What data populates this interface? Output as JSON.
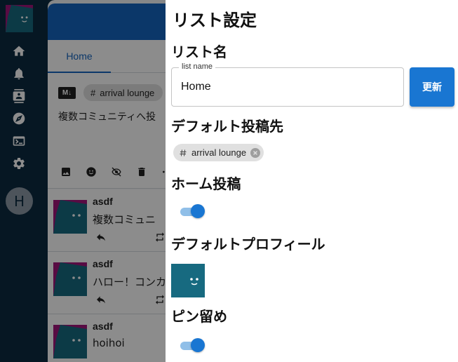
{
  "sidebar": {
    "avatar_label": "user avatar",
    "icons": [
      "home-icon",
      "bell-icon",
      "contacts-icon",
      "compass-icon",
      "terminal-icon",
      "gear-icon"
    ],
    "account_initial": "H"
  },
  "timeline": {
    "tab_label": "Home",
    "compose": {
      "markdown_badge": "M↓",
      "chip_label": "arrival lounge",
      "text": "複数コミュニティへ投"
    },
    "posts": [
      {
        "author": "asdf",
        "body": "複数コミュニ"
      },
      {
        "author": "asdf",
        "body": "ハロー！コンカ"
      },
      {
        "author": "asdf",
        "body": "hoihoi"
      }
    ]
  },
  "drawer": {
    "title": "リスト設定",
    "list_name_heading": "リスト名",
    "list_name_label": "list name",
    "list_name_value": "Home",
    "update_button": "更新",
    "default_destination_heading": "デフォルト投稿先",
    "destination_chip": "arrival lounge",
    "home_post_heading": "ホーム投稿",
    "home_post_enabled": true,
    "default_profile_heading": "デフォルトプロフィール",
    "pin_heading": "ピン留め",
    "pin_enabled": true
  },
  "colors": {
    "accent": "#1976d2",
    "sidebar_bg": "#0b2a40",
    "avatar_teal": "#176a80",
    "avatar_magenta": "#a0157a"
  }
}
